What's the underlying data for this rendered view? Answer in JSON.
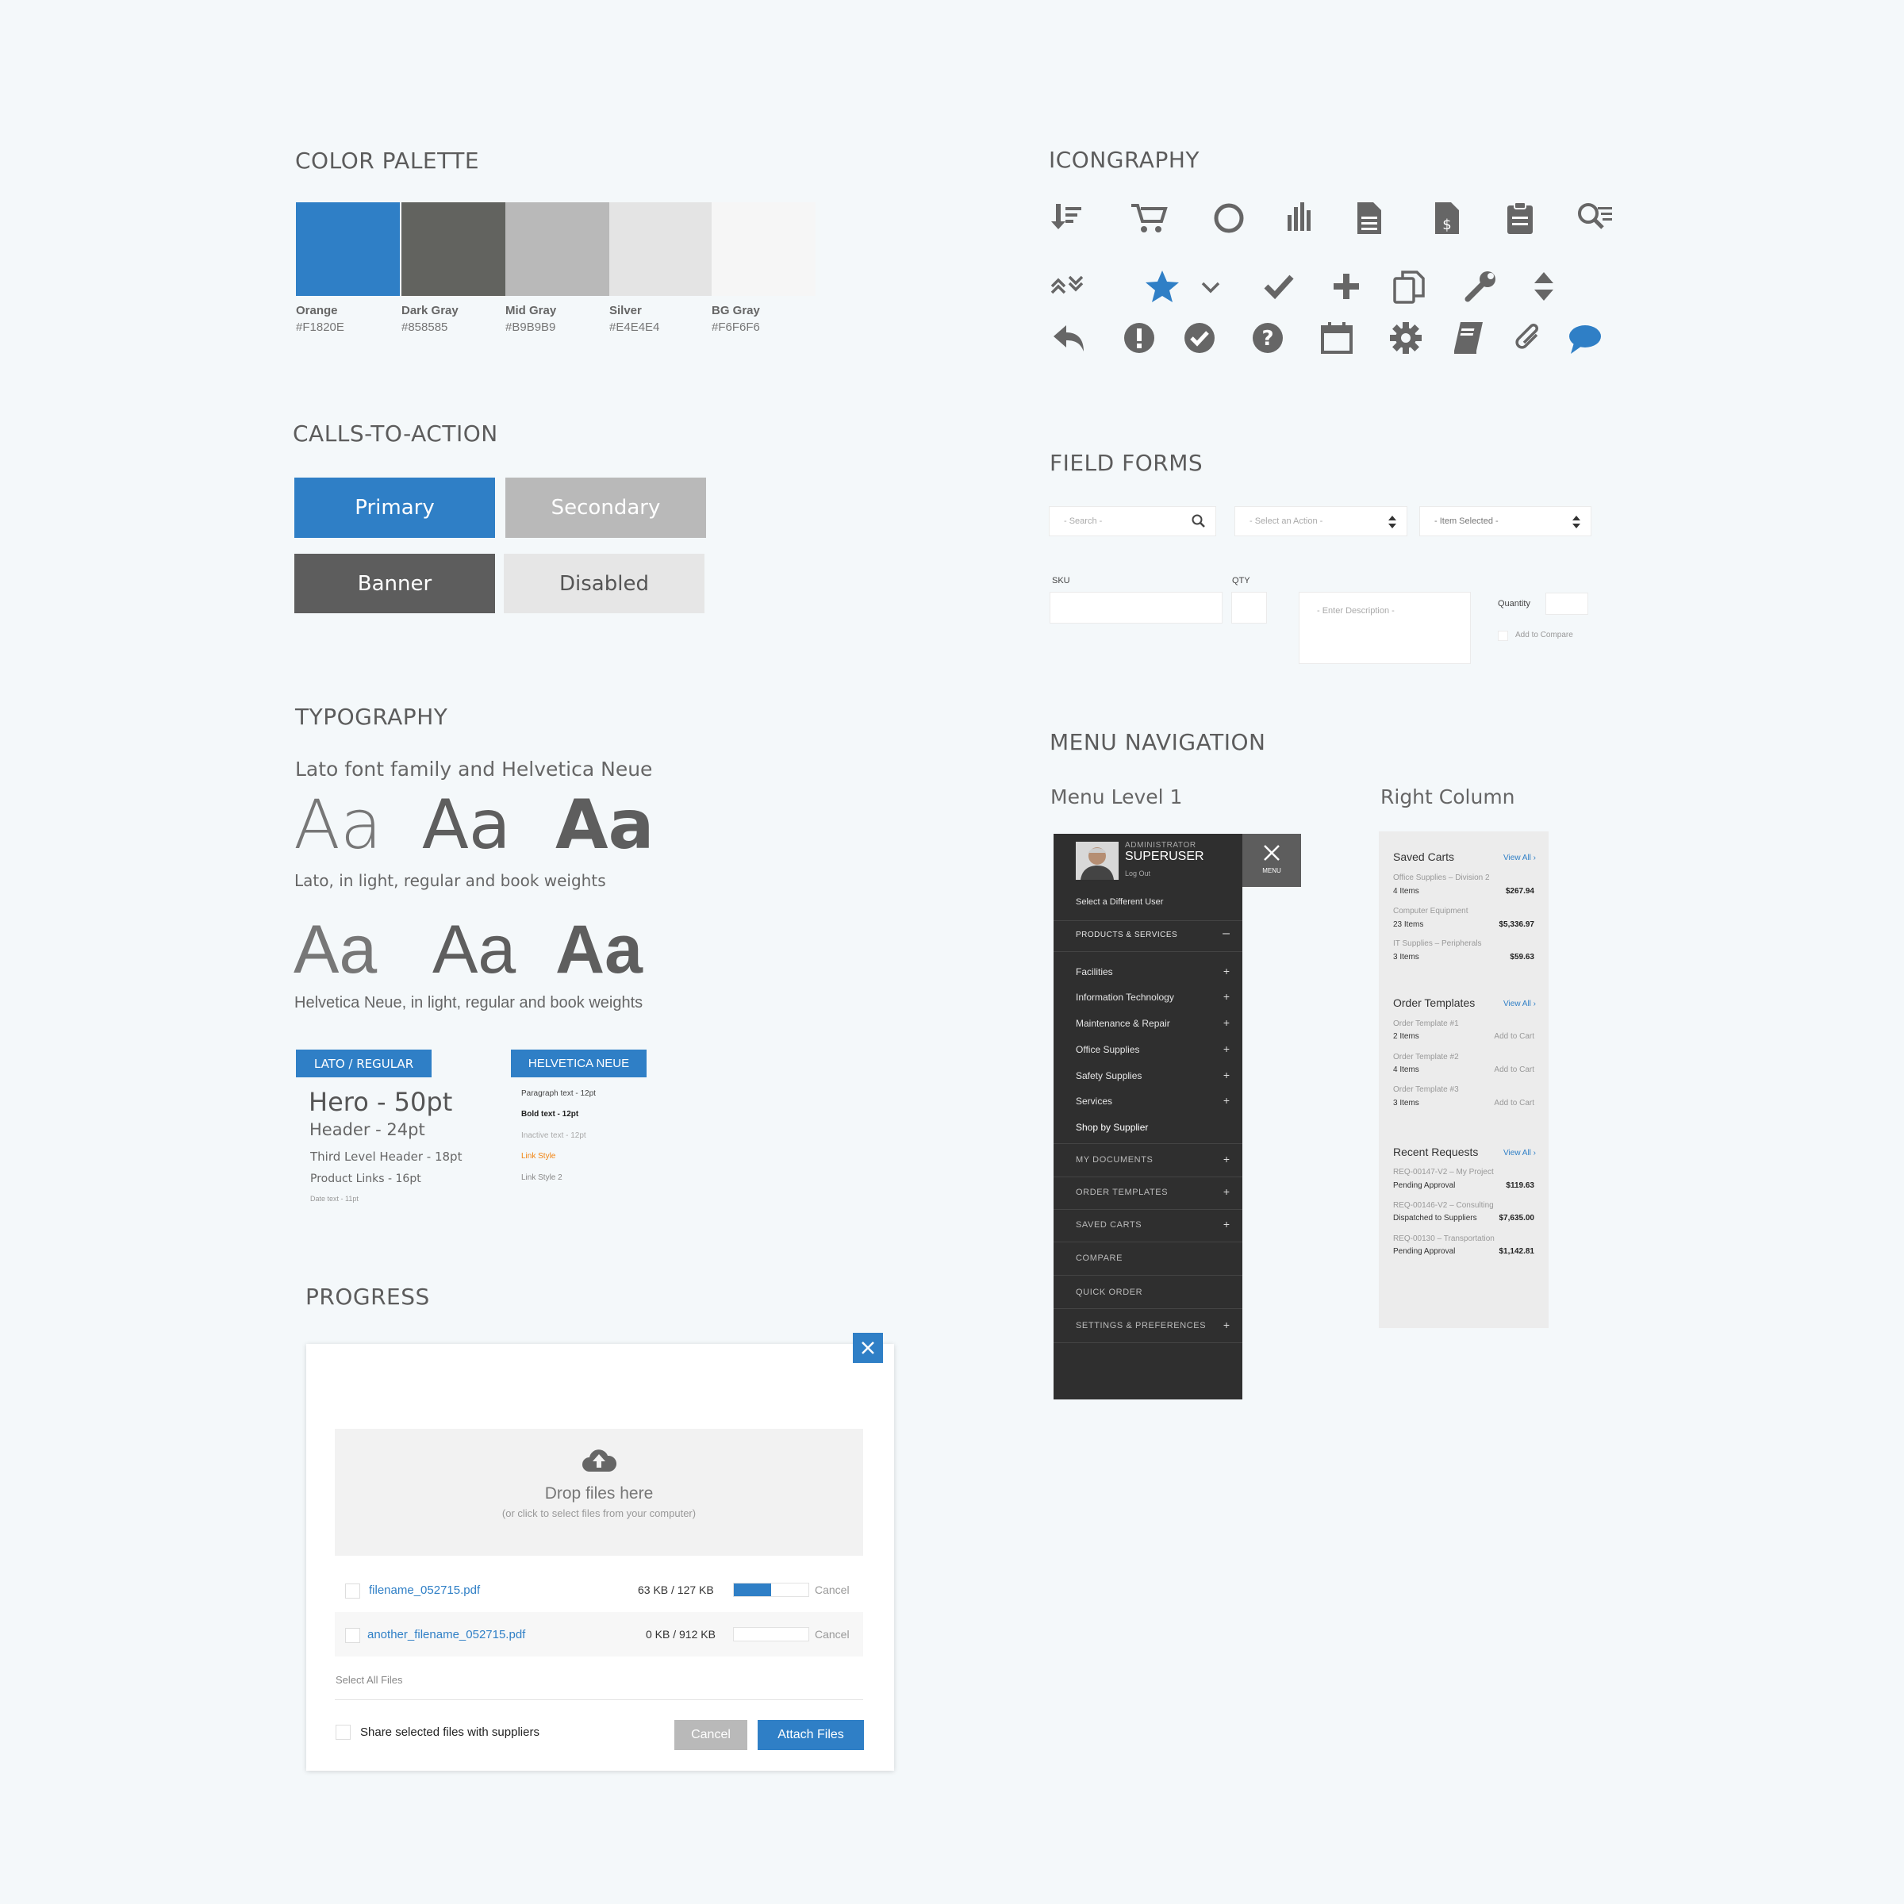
{
  "sections": {
    "palette": "COLOR PALETTE",
    "icons": "ICONGRAPHY",
    "cta": "CALLS-TO-ACTION",
    "forms": "FIELD FORMS",
    "typography": "TYPOGRAPHY",
    "menu": "MENU NAVIGATION",
    "progress": "PROGRESS"
  },
  "palette": [
    {
      "name": "Orange",
      "hex": "#F1820E",
      "color": "#2f7fc6"
    },
    {
      "name": "Dark Gray",
      "hex": "#858585",
      "color": "#62635f"
    },
    {
      "name": "Mid Gray",
      "hex": "#B9B9B9",
      "color": "#b9b9b9"
    },
    {
      "name": "Silver",
      "hex": "#E4E4E4",
      "color": "#e4e4e4"
    },
    {
      "name": "BG Gray",
      "hex": "#F6F6F6",
      "color": "#f6f6f6"
    }
  ],
  "cta": {
    "primary": "Primary",
    "secondary": "Secondary",
    "banner": "Banner",
    "disabled": "Disabled"
  },
  "icons": {
    "row1": [
      "sort-cart-icon",
      "shopping-cart-icon",
      "circle-icon",
      "bar-chart-icon",
      "document-icon",
      "invoice-icon",
      "clipboard-icon",
      "search-list-icon"
    ],
    "row2": [
      "expand-collapse-icon",
      "star-icon",
      "chevron-down-icon",
      "checkmark-icon",
      "plus-icon",
      "copy-icon",
      "wrench-icon",
      "sort-updown-icon"
    ],
    "row3": [
      "reply-icon",
      "alert-icon",
      "check-circle-icon",
      "help-icon",
      "calendar-icon",
      "gear-icon",
      "book-icon",
      "paperclip-icon",
      "chat-icon"
    ]
  },
  "forms": {
    "search_ph": "- Search -",
    "action_ph": "- Select an Action -",
    "item_selected": "- Item Selected -",
    "sku_label": "SKU",
    "qty_label": "QTY",
    "desc_ph": "- Enter Description -",
    "quantity_label": "Quantity",
    "compare_label": "Add to Compare"
  },
  "typography": {
    "family_line": "Lato font family and Helvetica Neue",
    "aa": "Aa",
    "lato_caption": "Lato, in light, regular and book weights",
    "helv_caption": "Helvetica Neue, in light, regular and book weights",
    "tag_lato": "LATO / REGULAR",
    "tag_helv": "HELVETICA NEUE",
    "lato_samples": [
      "Hero - 50pt",
      "Header - 24pt",
      "Third Level Header - 18pt",
      "Product Links - 16pt",
      "Date text - 11pt"
    ],
    "helv_samples": [
      "Paragraph text - 12pt",
      "Bold text - 12pt",
      "Inactive text - 12pt",
      "Link Style",
      "Link Style 2"
    ]
  },
  "menu": {
    "level_title": "Menu Level 1",
    "role": "ADMINISTRATOR",
    "user": "SUPERUSER",
    "logout": "Log Out",
    "menu_label": "MENU",
    "select_user": "Select a Different User",
    "products": "PRODUCTS & SERVICES",
    "items": [
      "Facilities",
      "Information Technology",
      "Maintenance & Repair",
      "Office Supplies",
      "Safety Supplies",
      "Services",
      "Shop by Supplier"
    ],
    "bottom": [
      "MY DOCUMENTS",
      "ORDER TEMPLATES",
      "SAVED CARTS",
      "COMPARE",
      "QUICK ORDER",
      "SETTINGS & PREFERENCES"
    ]
  },
  "right_col": {
    "title": "Right Column",
    "view_all": "View All ›",
    "saved_carts": "Saved Carts",
    "carts": [
      {
        "name": "Office Supplies – Division 2",
        "items": "4 Items",
        "price": "$267.94"
      },
      {
        "name": "Computer Equipment",
        "items": "23 Items",
        "price": "$5,336.97"
      },
      {
        "name": "IT Supplies – Peripherals",
        "items": "3 Items",
        "price": "$59.63"
      }
    ],
    "order_templates": "Order Templates",
    "templates": [
      {
        "name": "Order Template #1",
        "items": "2 Items",
        "action": "Add to Cart"
      },
      {
        "name": "Order Template #2",
        "items": "4 Items",
        "action": "Add to Cart"
      },
      {
        "name": "Order Template #3",
        "items": "3 Items",
        "action": "Add to Cart"
      }
    ],
    "recent_requests": "Recent Requests",
    "requests": [
      {
        "name": "REQ-00147-V2 – My Project",
        "status": "Pending Approval",
        "price": "$119.63"
      },
      {
        "name": "REQ-00146-V2 – Consulting",
        "status": "Dispatched to Suppliers",
        "price": "$7,635.00"
      },
      {
        "name": "REQ-00130 – Transportation",
        "status": "Pending Approval",
        "price": "$1,142.81"
      }
    ]
  },
  "progress": {
    "drop_title": "Drop files here",
    "drop_sub": "(or click to select files from your computer)",
    "files": [
      {
        "name": "filename_052715.pdf",
        "size": "63 KB / 127 KB",
        "progress": 0.5,
        "cancel": "Cancel"
      },
      {
        "name": "another_filename_052715.pdf",
        "size": "0 KB / 912 KB",
        "progress": 0,
        "cancel": "Cancel"
      }
    ],
    "select_all": "Select All Files",
    "share": "Share selected files with suppliers",
    "cancel": "Cancel",
    "attach": "Attach Files"
  }
}
